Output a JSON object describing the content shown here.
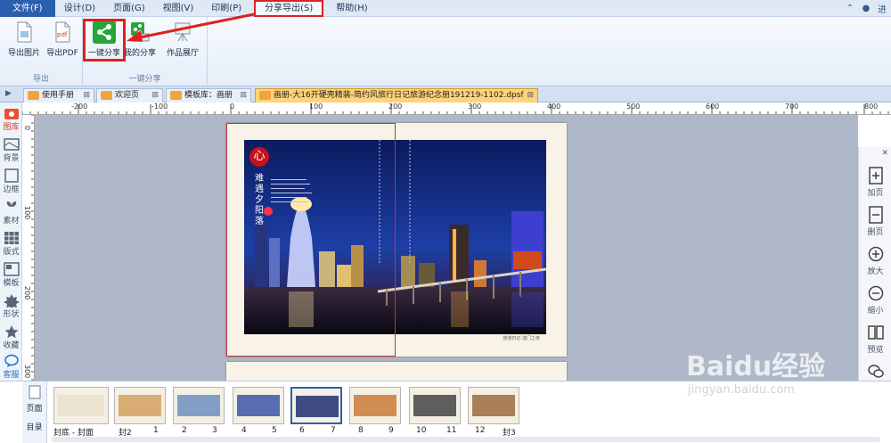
{
  "menu": {
    "file": "文件(F)",
    "items": [
      "设计(D)",
      "页面(G)",
      "视图(V)",
      "印刷(P)"
    ],
    "active": "分享导出(S)",
    "help": "帮助(H)",
    "right_label": "进"
  },
  "ribbon": {
    "export_image": "导出图片",
    "export_pdf": "导出PDF",
    "group_export": "导出",
    "one_click_share": "一键分享",
    "my_share": "我的分享",
    "works_hall": "作品展厅",
    "group_share": "一键分享"
  },
  "tabs": [
    {
      "label": "使用手册"
    },
    {
      "label": "欢迎页"
    },
    {
      "label": "模板库：画册"
    },
    {
      "label": "画册-大16开硬壳精装-简约风旅行日记旅游纪念册191219-1102.dpsf"
    }
  ],
  "left_tools": [
    "图库",
    "背景",
    "边框",
    "素材",
    "版式",
    "模板",
    "形状",
    "收藏",
    "客服"
  ],
  "ruler_h": [
    "-200",
    "-100",
    "0",
    "100",
    "200",
    "300",
    "400",
    "500",
    "600",
    "700",
    "800"
  ],
  "ruler_v": [
    "0",
    "100",
    "200",
    "300"
  ],
  "page": {
    "logo_char": "心",
    "vertical_title": "难遇夕阳落",
    "caption": "旅游日记·澳门之夜"
  },
  "right_panel": [
    "加页",
    "删页",
    "放大",
    "缩小",
    "预览",
    "分享"
  ],
  "thumb_side": {
    "pages": "页面",
    "catalog": "目录"
  },
  "thumbnails": [
    {
      "label": "封底 - 封面",
      "selected": false
    },
    {
      "label": "封2",
      "selected": false
    },
    {
      "label": "1",
      "selected": false
    },
    {
      "label": "2",
      "selected": false
    },
    {
      "label": "3",
      "selected": false
    },
    {
      "label": "4",
      "selected": false
    },
    {
      "label": "5",
      "selected": false
    },
    {
      "label": "6",
      "selected": true
    },
    {
      "label": "7",
      "selected": false
    },
    {
      "label": "8",
      "selected": false
    },
    {
      "label": "9",
      "selected": false
    },
    {
      "label": "10",
      "selected": false
    },
    {
      "label": "11",
      "selected": false
    },
    {
      "label": "12",
      "selected": false
    },
    {
      "label": "封3",
      "selected": false
    }
  ],
  "watermark": {
    "brand": "Baidu经验",
    "url": "jingyan.baidu.com"
  },
  "colors": {
    "accent": "#2b5fae",
    "highlight": "#e02020",
    "active_tab": "#ffd37a"
  }
}
